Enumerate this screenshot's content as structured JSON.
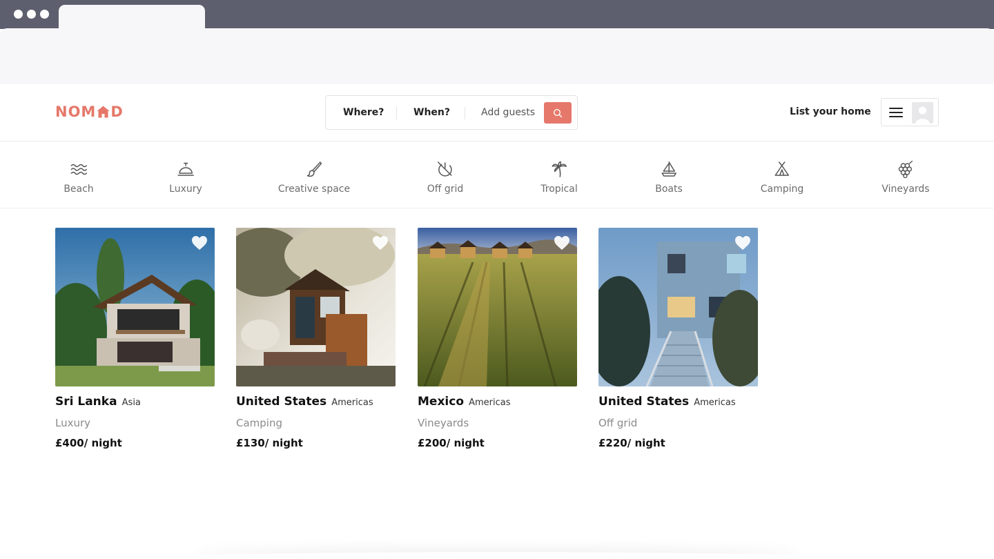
{
  "brand": {
    "logo_text_left": "NOM",
    "logo_text_right": "D",
    "accent_color": "#e5786a"
  },
  "search": {
    "where_label": "Where?",
    "when_label": "When?",
    "guests_label": "Add guests",
    "button_icon": "search-icon"
  },
  "header": {
    "list_home_label": "List your home",
    "menu_icon": "hamburger-icon",
    "avatar_icon": "user-avatar-icon"
  },
  "categories": [
    {
      "label": "Beach",
      "icon": "waves-icon"
    },
    {
      "label": "Luxury",
      "icon": "service-bell-icon"
    },
    {
      "label": "Creative space",
      "icon": "paintbrush-icon"
    },
    {
      "label": "Off grid",
      "icon": "off-grid-icon"
    },
    {
      "label": "Tropical",
      "icon": "palm-tree-icon"
    },
    {
      "label": "Boats",
      "icon": "sailboat-icon"
    },
    {
      "label": "Camping",
      "icon": "tent-icon"
    },
    {
      "label": "Vineyards",
      "icon": "grapes-icon"
    }
  ],
  "listings": [
    {
      "country": "Sri Lanka",
      "region": "Asia",
      "category": "Luxury",
      "price": "£400/ night",
      "image": "modern-house-photo"
    },
    {
      "country": "United States",
      "region": "Americas",
      "category": "Camping",
      "price": "£130/ night",
      "image": "treehouse-cabin-photo"
    },
    {
      "country": "Mexico",
      "region": "Americas",
      "category": "Vineyards",
      "price": "£200/ night",
      "image": "vineyard-cabins-photo"
    },
    {
      "country": "United States",
      "region": "Americas",
      "category": "Off grid",
      "price": "£220/ night",
      "image": "blue-house-boardwalk-photo"
    }
  ]
}
